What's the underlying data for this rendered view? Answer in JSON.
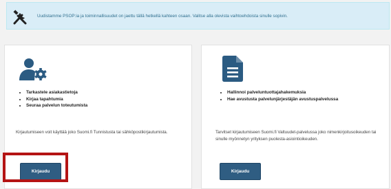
{
  "notice": {
    "text": "Uudistamme PSOP:ia ja toiminnallisuudet on jaettu tällä hetkellä kahteen osaan. Valitse alla olevista vaihtoehdoista sinulle sopivin.",
    "icon": "tools-icon"
  },
  "cards": [
    {
      "icon": "user-gear-icon",
      "features": [
        "Tarkastele asiakastietoja",
        "Kirjaa tapahtumia",
        "Seuraa palvelun toteutumista"
      ],
      "description": [
        "Kirjautumiseen voit käyttää joko Suomi.fi Tunnistusta tai sähköpostikirjautumista."
      ],
      "button_label": "Kirjaudu"
    },
    {
      "icon": "document-icon",
      "features": [
        "Hallinnoi palveluntuottajahakemuksia",
        "Hae avustusta palvelunjärjestäjän avustuspalvelussa"
      ],
      "description": [
        "Tarvitset kirjautumiseen Suomi.fi Valtuudet-palvelussa joko nimenkirjoitusoikeuden tai",
        "sinulle myönnetyn yrityksen puolesta-asiointioikeuden."
      ],
      "button_label": "Kirjaudu"
    }
  ],
  "colors": {
    "notice_bg": "#d9edf7",
    "icon": "#2b5b82",
    "button": "#2f5d82",
    "highlight": "#b41414"
  }
}
